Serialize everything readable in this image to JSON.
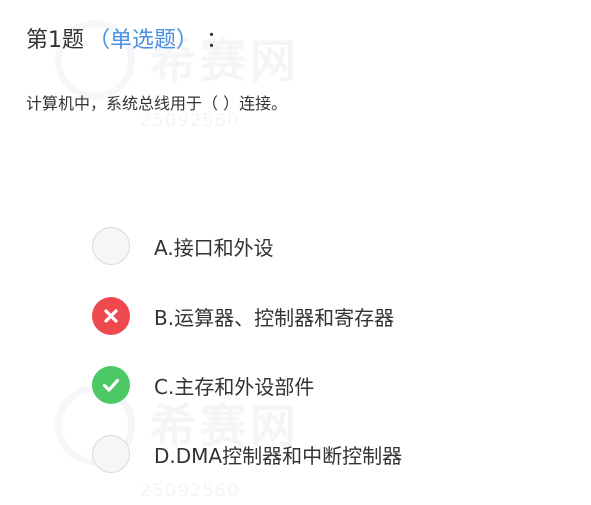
{
  "question": {
    "number": "第1题",
    "type": "（单选题）",
    "colon": "：",
    "text": "计算机中，系统总线用于（   ）连接。"
  },
  "options": [
    {
      "label": "A.接口和外设",
      "state": "unselected",
      "icon": "empty-radio-icon"
    },
    {
      "label": "B.运算器、控制器和寄存器",
      "state": "wrong",
      "icon": "cross-icon"
    },
    {
      "label": "C.主存和外设部件",
      "state": "correct",
      "icon": "check-icon"
    },
    {
      "label": "D.DMA控制器和中断控制器",
      "state": "unselected",
      "icon": "empty-radio-icon"
    }
  ],
  "watermark": {
    "name": "希赛网",
    "number": "25092560"
  },
  "colors": {
    "type_blue": "#4a90e2",
    "wrong_red": "#f0484f",
    "correct_green": "#4cc864",
    "text": "#333333"
  }
}
